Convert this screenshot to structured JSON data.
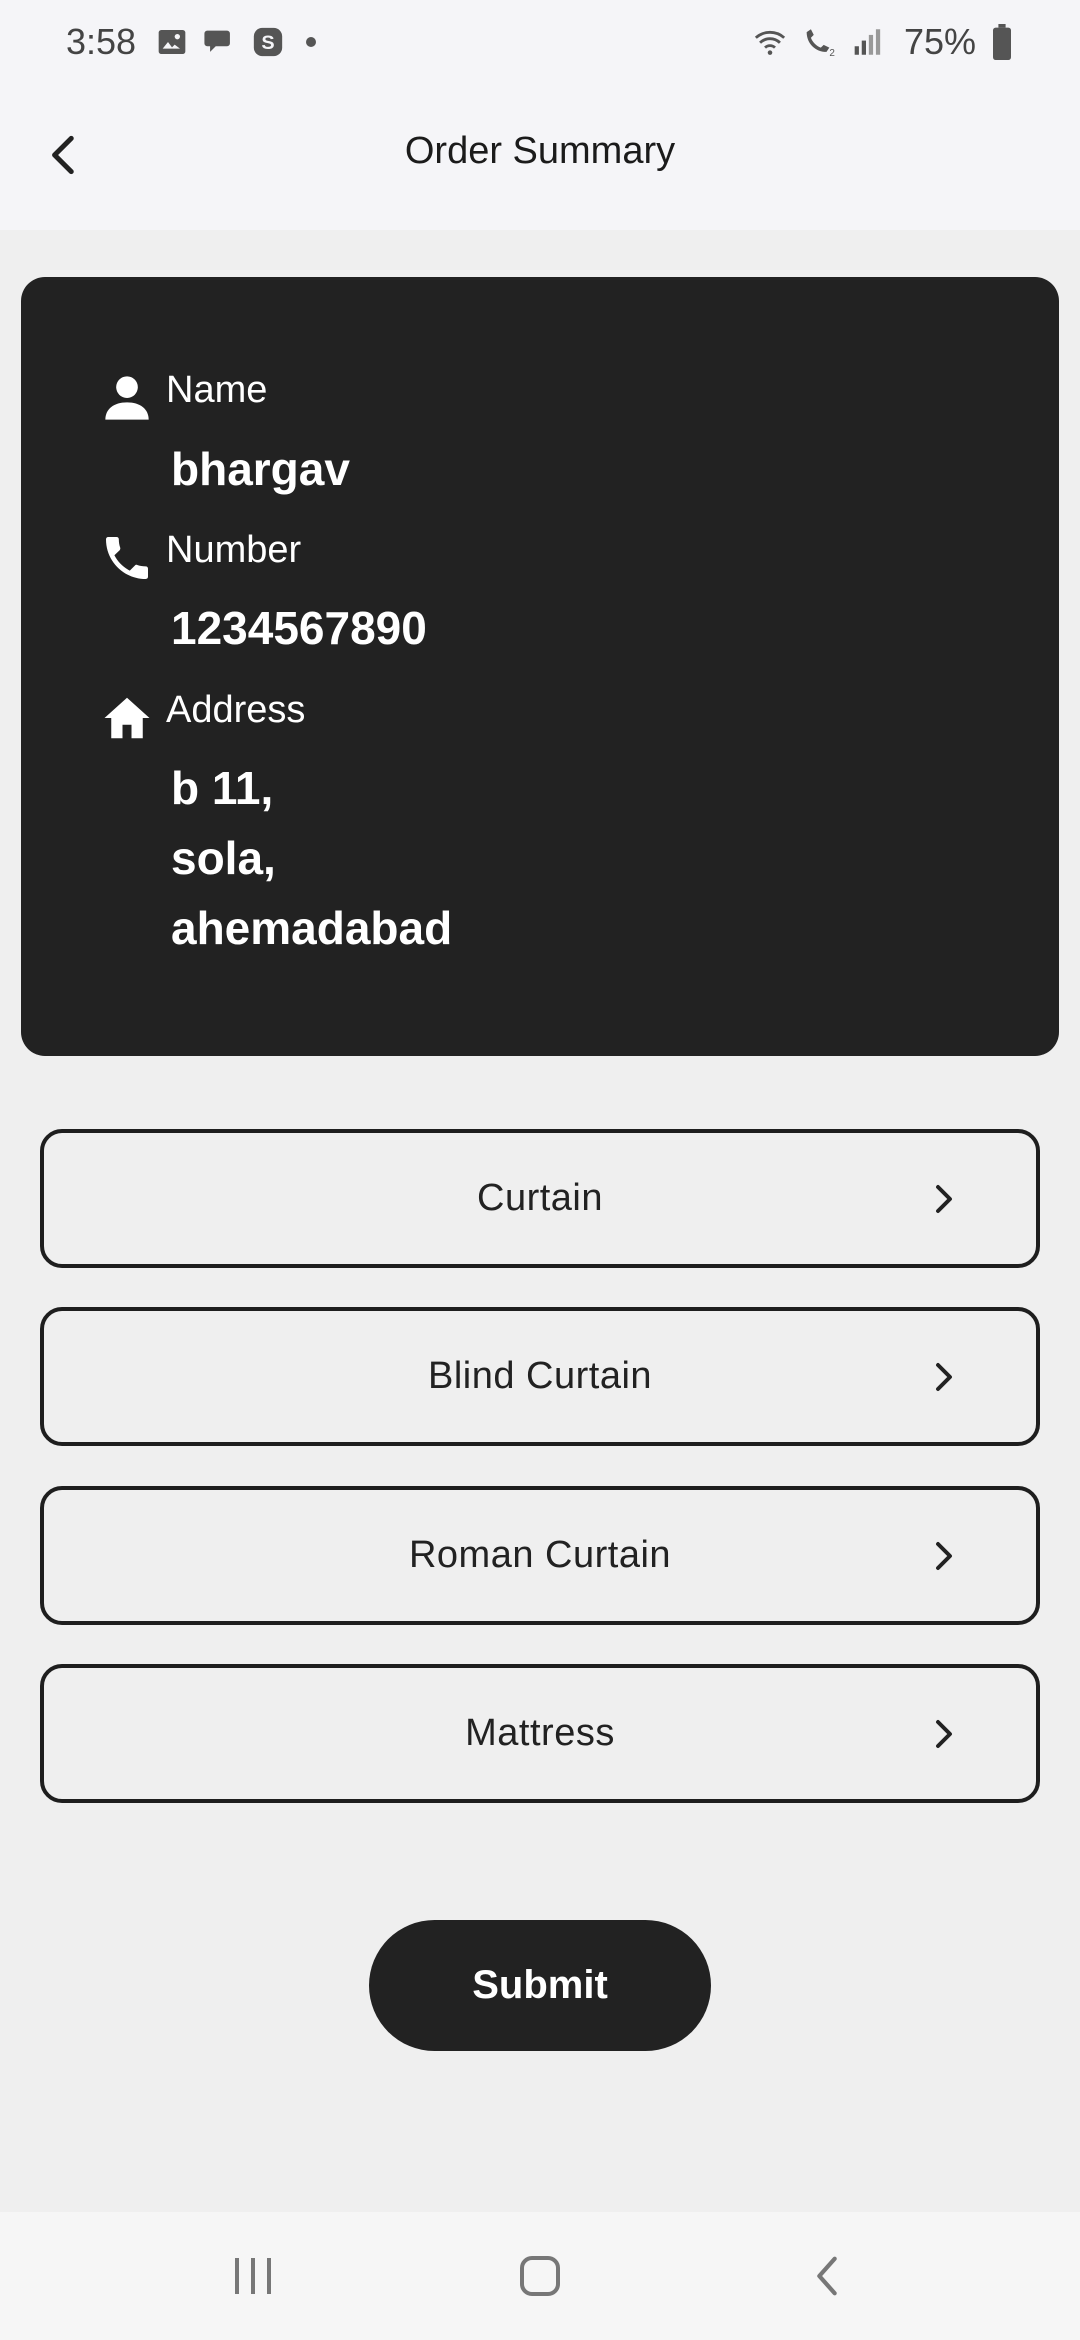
{
  "status_bar": {
    "time": "3:58",
    "battery": "75%",
    "left_icons": [
      "gallery-icon",
      "chat-icon",
      "skype-icon"
    ],
    "right_icons": [
      "wifi-icon",
      "wifi-calling-icon",
      "signal-icon",
      "battery-icon"
    ]
  },
  "app_bar": {
    "title": "Order Summary",
    "back_icon": "arrow-back-icon"
  },
  "customer": {
    "name_label": "Name",
    "name_value": "bhargav",
    "number_label": "Number",
    "number_value": "1234567890",
    "address_label": "Address",
    "address_lines": [
      "b 11,",
      "sola,",
      "ahemadabad"
    ],
    "icons": [
      "person-icon",
      "phone-icon",
      "home-icon"
    ]
  },
  "categories": [
    {
      "label": "Curtain"
    },
    {
      "label": "Blind Curtain"
    },
    {
      "label": "Roman Curtain"
    },
    {
      "label": "Mattress"
    }
  ],
  "submit_label": "Submit",
  "nav": {
    "icons": [
      "recent-apps-icon",
      "home-button-icon",
      "back-nav-icon"
    ]
  },
  "colors": {
    "card_bg": "#222222",
    "page_bg": "#efefef",
    "app_bar_bg": "#f5f5f8",
    "accent": "#222222"
  }
}
